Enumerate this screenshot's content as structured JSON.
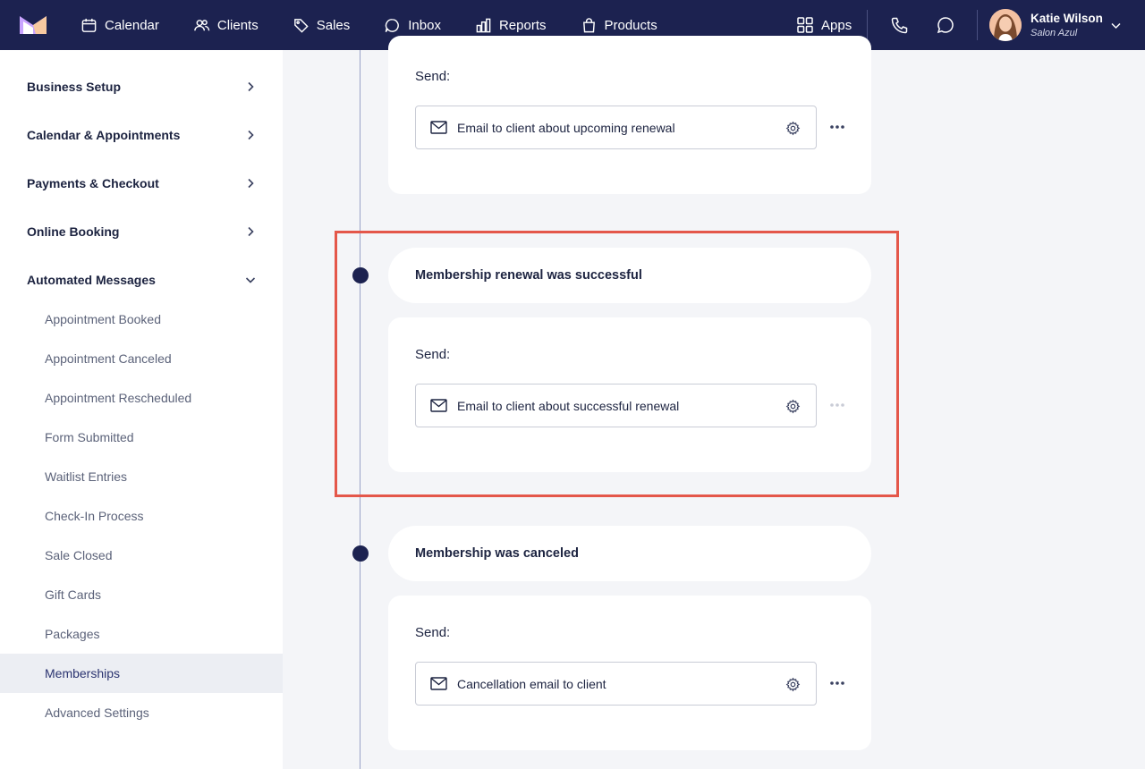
{
  "topbar": {
    "nav": [
      {
        "label": "Calendar",
        "icon": "calendar-icon"
      },
      {
        "label": "Clients",
        "icon": "users-icon"
      },
      {
        "label": "Sales",
        "icon": "tag-icon"
      },
      {
        "label": "Inbox",
        "icon": "inbox-icon"
      },
      {
        "label": "Reports",
        "icon": "bar-chart-icon"
      },
      {
        "label": "Products",
        "icon": "shopping-bag-icon"
      }
    ],
    "apps_label": "Apps",
    "user": {
      "name": "Katie Wilson",
      "business": "Salon Azul"
    }
  },
  "sidebar": {
    "sections": [
      {
        "label": "Business Setup",
        "expanded": false
      },
      {
        "label": "Calendar & Appointments",
        "expanded": false
      },
      {
        "label": "Payments & Checkout",
        "expanded": false
      },
      {
        "label": "Online Booking",
        "expanded": false
      },
      {
        "label": "Automated Messages",
        "expanded": true
      }
    ],
    "subitems": [
      "Appointment Booked",
      "Appointment Canceled",
      "Appointment Rescheduled",
      "Form Submitted",
      "Waitlist Entries",
      "Check-In Process",
      "Sale Closed",
      "Gift Cards",
      "Packages",
      "Memberships",
      "Advanced Settings"
    ],
    "active_subitem": "Memberships"
  },
  "main": {
    "send_label": "Send:",
    "events": [
      {
        "title": "",
        "message": "Email to client about upcoming renewal",
        "more_enabled": true
      },
      {
        "title": "Membership renewal was successful",
        "message": "Email to client about successful renewal",
        "more_enabled": false
      },
      {
        "title": "Membership was canceled",
        "message": "Cancellation email to client",
        "more_enabled": true
      }
    ]
  },
  "colors": {
    "topbar": "#1c2250",
    "highlight": "#e4574a",
    "timeline_dot": "#1c2250",
    "background": "#f4f5f8"
  }
}
